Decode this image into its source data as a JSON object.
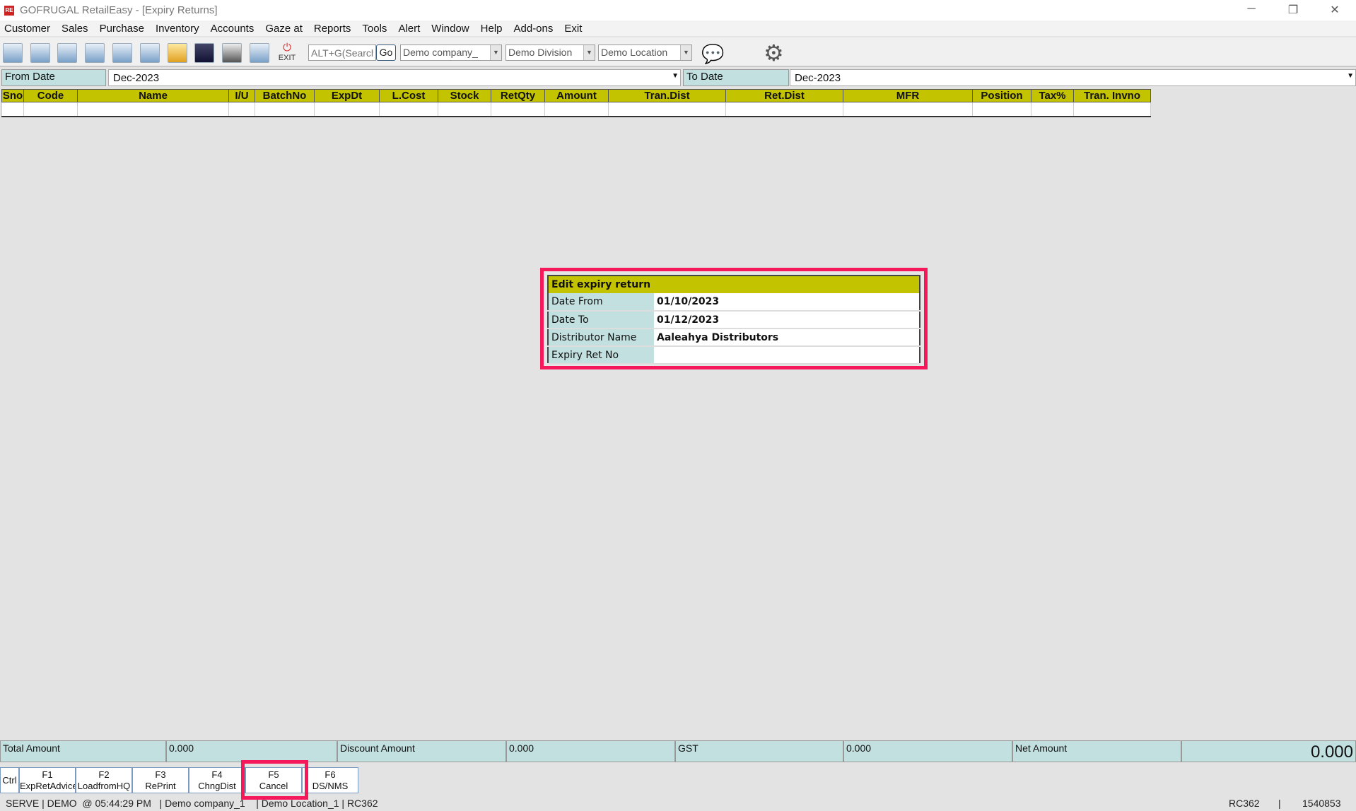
{
  "window": {
    "title": "GOFRUGAL RetailEasy - [Expiry Returns]",
    "minimize": "─",
    "restore": "❐",
    "close": "✕"
  },
  "menu": [
    "Customer",
    "Sales",
    "Purchase",
    "Inventory",
    "Accounts",
    "Gaze at",
    "Reports",
    "Tools",
    "Alert",
    "Window",
    "Help",
    "Add-ons",
    "Exit"
  ],
  "toolbar": {
    "icons": [
      "new-bill-icon",
      "purchase-cart-icon",
      "print-icon",
      "barcode-icon",
      "document-icon",
      "cart-document-icon",
      "folder-icon",
      "users-icon",
      "bar-chart-icon",
      "report-chart-icon"
    ],
    "exit_label": "EXIT",
    "search_placeholder": "ALT+G(Search",
    "go_label": "Go",
    "company": "Demo company_",
    "division": "Demo Division",
    "location": "Demo Location"
  },
  "filters": {
    "from_label": "From Date",
    "from_value": "Dec-2023",
    "to_label": "To Date",
    "to_value": "Dec-2023"
  },
  "grid": {
    "columns": [
      "Sno",
      "Code",
      "Name",
      "I/U",
      "BatchNo",
      "ExpDt",
      "L.Cost",
      "Stock",
      "RetQty",
      "Amount",
      "Tran.Dist",
      "Ret.Dist",
      "MFR",
      "Position",
      "Tax%",
      "Tran. Invno"
    ]
  },
  "dialog": {
    "title": "Edit expiry return",
    "rows": [
      {
        "label": "Date From",
        "value": "01/10/2023"
      },
      {
        "label": "Date To",
        "value": "01/12/2023"
      },
      {
        "label": "Distributor Name",
        "value": "Aaleahya  Distributors"
      },
      {
        "label": "Expiry Ret No",
        "value": ""
      }
    ]
  },
  "totals": {
    "total_label": "Total Amount",
    "total": "0.000",
    "discount_label": "Discount Amount",
    "discount": "0.000",
    "gst_label": "GST",
    "gst": "0.000",
    "net_label": "Net Amount",
    "net": "0.000"
  },
  "fkeys": [
    {
      "key": "Ctrl",
      "label": ""
    },
    {
      "key": "F1",
      "label": "ExpRetAdvice"
    },
    {
      "key": "F2",
      "label": "LoadfromHQ"
    },
    {
      "key": "F3",
      "label": "RePrint"
    },
    {
      "key": "F4",
      "label": "ChngDist"
    },
    {
      "key": "F5",
      "label": "Cancel"
    },
    {
      "key": "F6",
      "label": "DS/NMS"
    }
  ],
  "status": {
    "left": "SERVE | DEMO  @ 05:44:29 PM   | Demo company_1    | Demo Location_1 | RC362",
    "code": "RC362",
    "sep": "|",
    "number": "1540853"
  }
}
